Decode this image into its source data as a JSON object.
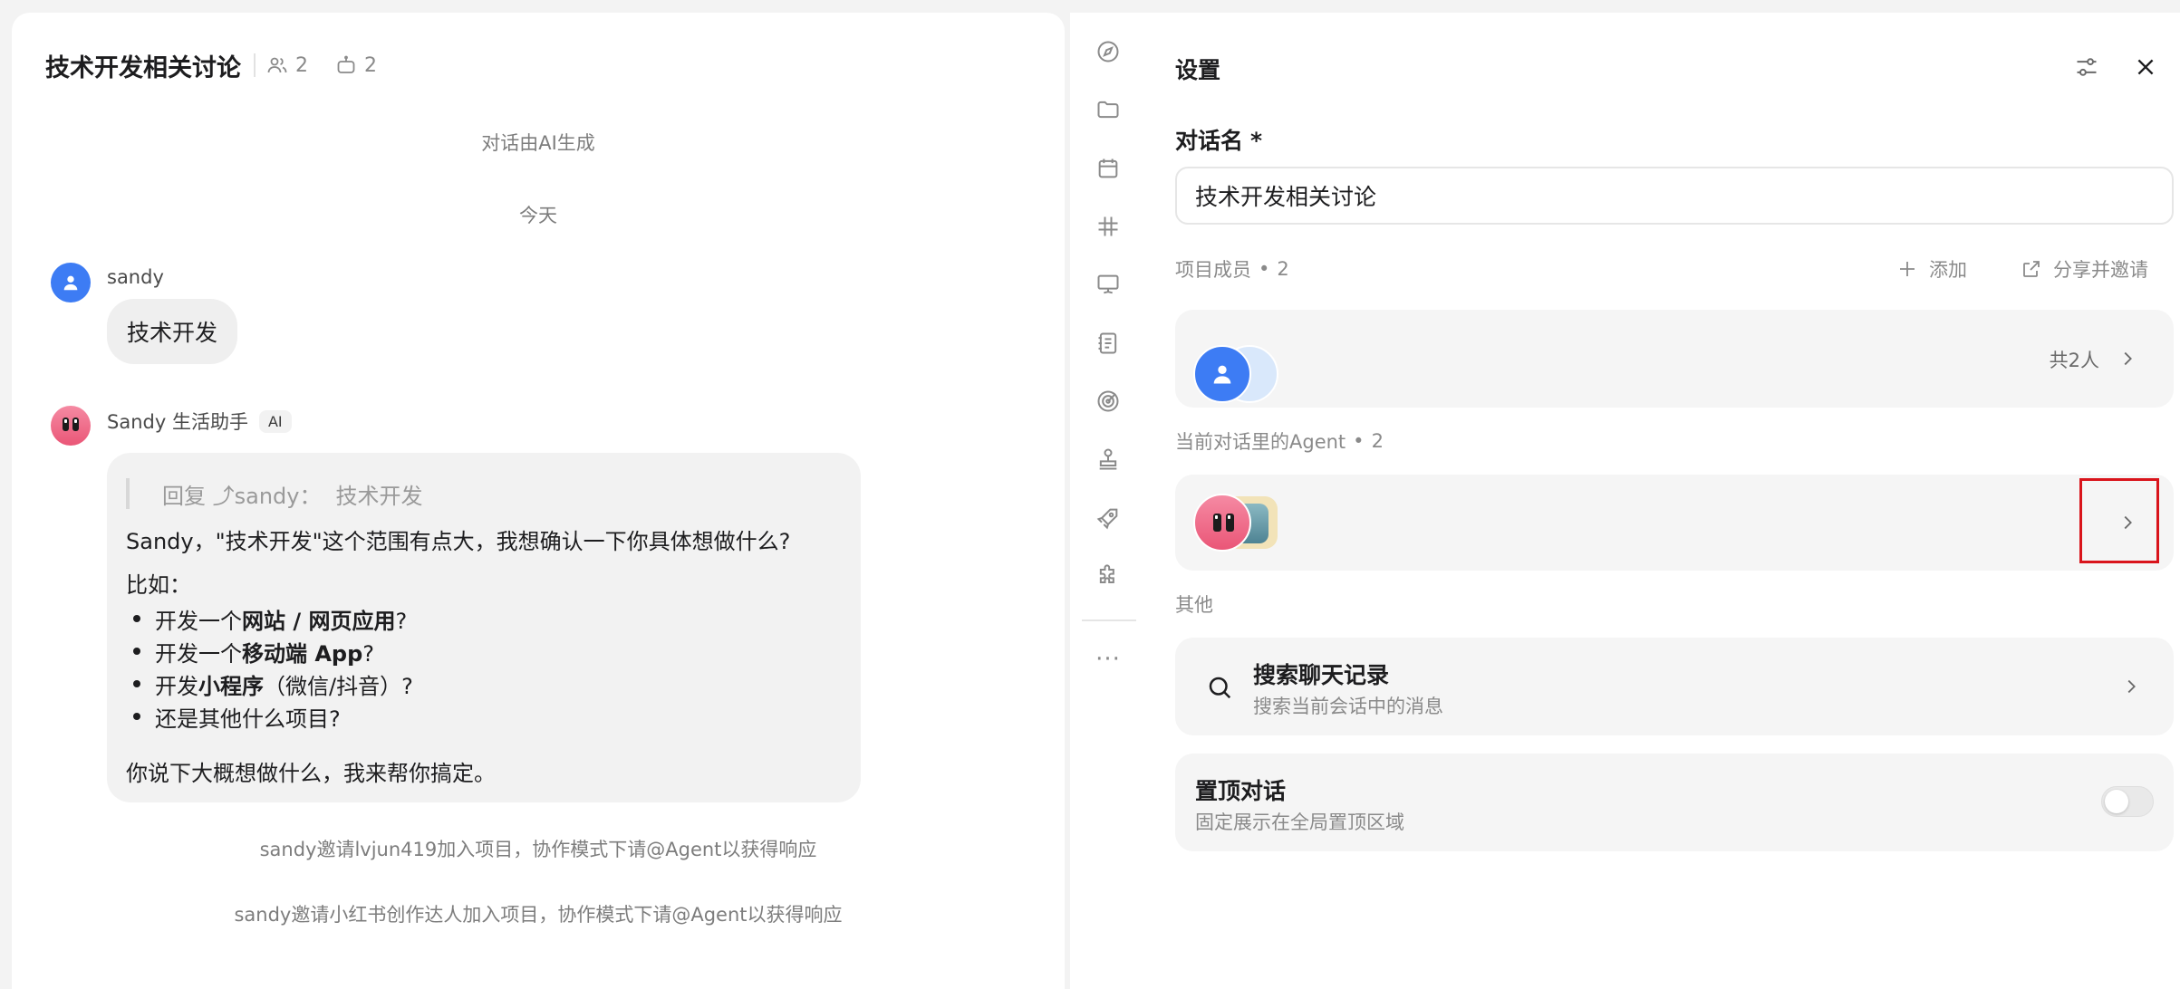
{
  "chat": {
    "title": "技术开发相关讨论",
    "member_count": "2",
    "agent_count": "2",
    "system_note": "对话由AI生成",
    "date_divider": "今天",
    "user_message": {
      "sender": "sandy",
      "text": "技术开发"
    },
    "bot_message": {
      "sender": "Sandy 生活助手",
      "badge": "AI",
      "reply_prefix": "回复 ⤴sandy：",
      "reply_text": "技术开发",
      "intro": "Sandy，\"技术开发\"这个范围有点大，我想确认一下你具体想做什么?",
      "lead": "比如：",
      "items": [
        {
          "pre": "开发一个",
          "bold": "网站 / 网页应用",
          "post": "?"
        },
        {
          "pre": "开发一个",
          "bold": "移动端 App",
          "post": "?"
        },
        {
          "pre": "开发",
          "bold": "小程序",
          "post": "（微信/抖音）?"
        },
        {
          "pre": "还是其他什么项目?",
          "bold": "",
          "post": ""
        }
      ],
      "closing": "你说下大概想做什么，我来帮你搞定。"
    },
    "invite_notes": [
      "sandy邀请lvjun419加入项目，协作模式下请@Agent以获得响应",
      "sandy邀请小红书创作达人加入项目，协作模式下请@Agent以获得响应"
    ]
  },
  "rail": {
    "icons": [
      "compass-icon",
      "folder-icon",
      "calendar-icon",
      "hashtag-icon",
      "presentation-icon",
      "notebook-icon",
      "target-icon",
      "stamp-icon",
      "rocket-icon",
      "puzzle-icon"
    ],
    "more": "···"
  },
  "settings": {
    "title": "设置",
    "name_label": "对话名",
    "required_mark": "*",
    "name_value": "技术开发相关讨论",
    "members": {
      "label": "项目成员",
      "dot": "•",
      "count": "2",
      "add_label": "添加",
      "share_label": "分享并邀请",
      "total": "共2人"
    },
    "agents": {
      "label": "当前对话里的Agent",
      "dot": "•",
      "count": "2"
    },
    "other_label": "其他",
    "search_history": {
      "title": "搜索聊天记录",
      "desc": "搜索当前会话中的消息"
    },
    "pin_chat": {
      "title": "置顶对话",
      "desc": "固定展示在全局置顶区域",
      "enabled": false
    }
  },
  "colors": {
    "accent_blue": "#3d7cf4",
    "highlight_red": "#d9141b",
    "panel_bg": "#f5f5f5"
  }
}
